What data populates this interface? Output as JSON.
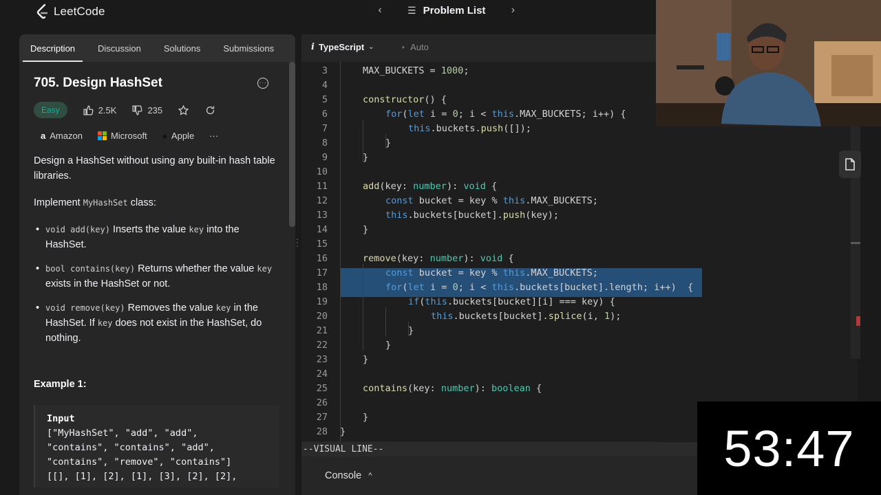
{
  "app": {
    "logo_text": "LeetCode"
  },
  "nav": {
    "list_label": "Problem List"
  },
  "tabs": [
    "Description",
    "Discussion",
    "Solutions",
    "Submissions"
  ],
  "problem": {
    "title": "705. Design HashSet",
    "difficulty": "Easy",
    "likes": "2.5K",
    "dislikes": "235",
    "companies": [
      "Amazon",
      "Microsoft",
      "Apple"
    ],
    "description": {
      "p1": "Design a HashSet without using any built-in hash table libraries.",
      "p2_pre": "Implement ",
      "p2_code": "MyHashSet",
      "p2_post": " class:",
      "bullets": [
        {
          "code": "void add(key)",
          "text1": " Inserts the value ",
          "code2": "key",
          "text2": " into the HashSet."
        },
        {
          "code": "bool contains(key)",
          "text1": " Returns whether the value ",
          "code2": "key",
          "text2": " exists in the HashSet or not."
        },
        {
          "code": "void remove(key)",
          "text1": " Removes the value ",
          "code2": "key",
          "text2": " in the HashSet. If ",
          "code3": "key",
          "text3": " does not exist in the HashSet, do nothing."
        }
      ]
    },
    "example_heading": "Example 1:",
    "example": {
      "label": "Input",
      "lines": [
        "[\"MyHashSet\", \"add\", \"add\",",
        "\"contains\", \"contains\", \"add\",",
        "\"contains\", \"remove\", \"contains\"]",
        "[[], [1], [2], [1], [3], [2], [2],"
      ]
    }
  },
  "editor": {
    "language": "TypeScript",
    "mode": "Auto",
    "status_line": "--VISUAL LINE--",
    "console_label": "Console",
    "lines": [
      {
        "n": "3",
        "code": "MAX_BUCKETS = 1000;"
      },
      {
        "n": "4",
        "code": ""
      },
      {
        "n": "5",
        "code": "constructor() {"
      },
      {
        "n": "6",
        "code": "for(let i = 0; i < this.MAX_BUCKETS; i++) {"
      },
      {
        "n": "7",
        "code": "this.buckets.push([]);"
      },
      {
        "n": "8",
        "code": "}"
      },
      {
        "n": "9",
        "code": "}"
      },
      {
        "n": "10",
        "code": ""
      },
      {
        "n": "11",
        "code": "add(key: number): void {"
      },
      {
        "n": "12",
        "code": "const bucket = key % this.MAX_BUCKETS;"
      },
      {
        "n": "13",
        "code": "this.buckets[bucket].push(key);"
      },
      {
        "n": "14",
        "code": "}"
      },
      {
        "n": "15",
        "code": ""
      },
      {
        "n": "16",
        "code": "remove(key: number): void {"
      },
      {
        "n": "17",
        "code": "const bucket = key % this.MAX_BUCKETS;"
      },
      {
        "n": "18",
        "code": "for(let i = 0; i < this.buckets[bucket].length; i++)  {"
      },
      {
        "n": "19",
        "code": "if(this.buckets[bucket][i] === key) {"
      },
      {
        "n": "20",
        "code": "this.buckets[bucket].splice(i, 1);"
      },
      {
        "n": "21",
        "code": "}"
      },
      {
        "n": "22",
        "code": "}"
      },
      {
        "n": "23",
        "code": "}"
      },
      {
        "n": "24",
        "code": ""
      },
      {
        "n": "25",
        "code": "contains(key: number): boolean {"
      },
      {
        "n": "26",
        "code": ""
      },
      {
        "n": "27",
        "code": "}"
      },
      {
        "n": "28",
        "code": "}"
      }
    ]
  },
  "timer": "53:47",
  "colors": {
    "easy": "#00b8a3",
    "selection": "#264f78"
  }
}
